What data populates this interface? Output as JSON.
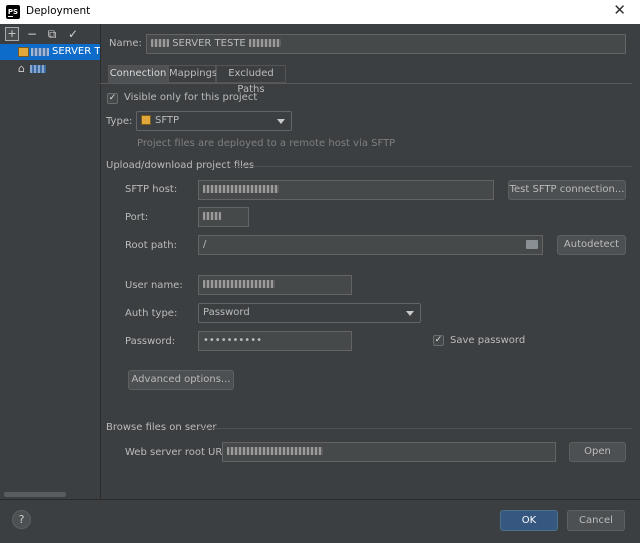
{
  "window": {
    "title": "Deployment",
    "app_icon_text": "PS",
    "close_glyph": "✕"
  },
  "sidebar": {
    "toolbar": {
      "add": "+",
      "remove": "−",
      "copy": "⧉",
      "apply": "✓"
    },
    "server_name": "SERVER TESTE",
    "home_icon": "⌂"
  },
  "name_field": {
    "label": "Name:",
    "value": "SERVER TESTE"
  },
  "tabs": [
    {
      "label": "Connection",
      "active": true
    },
    {
      "label": "Mappings",
      "active": false
    },
    {
      "label": "Excluded Paths",
      "active": false
    }
  ],
  "visible_only": {
    "label": "Visible only for this project",
    "checked": true
  },
  "type": {
    "label": "Type:",
    "value": "SFTP",
    "hint": "Project files are deployed to a remote host via SFTP"
  },
  "upload_section": {
    "title": "Upload/download project files",
    "host_label": "SFTP host:",
    "test_button": "Test SFTP connection...",
    "port_label": "Port:",
    "root_label": "Root path:",
    "root_value": "/",
    "autodetect_button": "Autodetect",
    "user_label": "User name:",
    "auth_label": "Auth type:",
    "auth_value": "Password",
    "password_label": "Password:",
    "password_value": "••••••••••",
    "save_password": {
      "label": "Save password",
      "checked": true
    },
    "advanced_button": "Advanced options..."
  },
  "browse_section": {
    "title": "Browse files on server",
    "url_label": "Web server root URL:",
    "open_button": "Open"
  },
  "footer": {
    "help": "?",
    "ok": "OK",
    "cancel": "Cancel"
  }
}
